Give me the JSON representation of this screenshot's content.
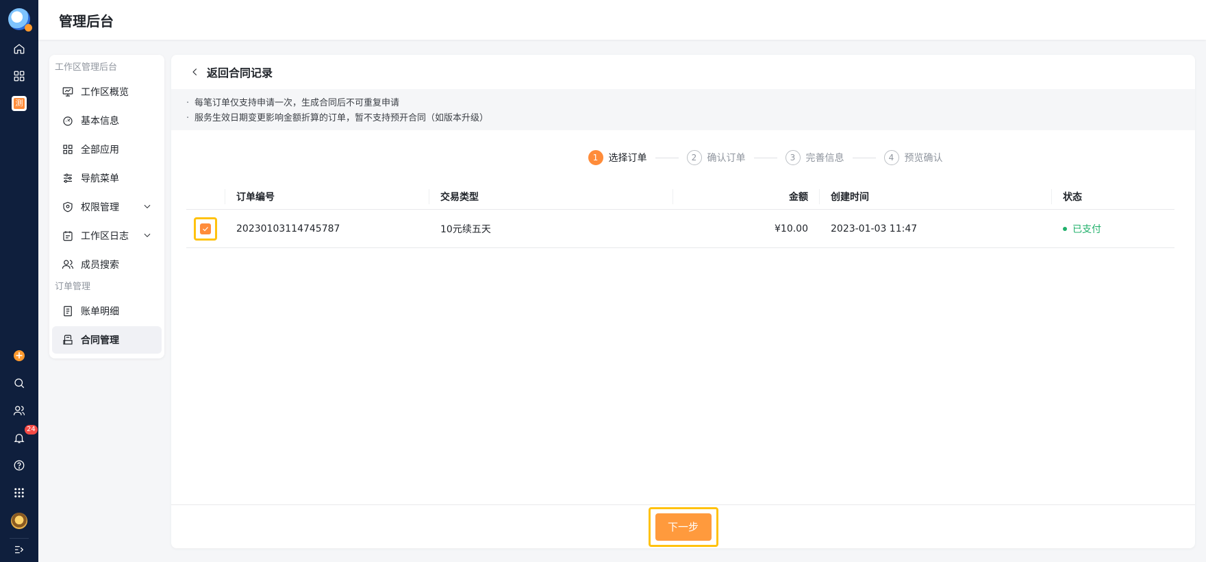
{
  "header": {
    "title": "管理后台"
  },
  "rail": {
    "notification_count": "24",
    "app_glyph": "测"
  },
  "sidenav": {
    "group_workspace": "工作区管理后台",
    "items_workspace": [
      {
        "label": "工作区概览",
        "icon": "monitor-icon"
      },
      {
        "label": "基本信息",
        "icon": "dashboard-icon"
      },
      {
        "label": "全部应用",
        "icon": "grid-icon"
      },
      {
        "label": "导航菜单",
        "icon": "sliders-icon"
      },
      {
        "label": "权限管理",
        "icon": "shield-icon"
      },
      {
        "label": "工作区日志",
        "icon": "calendar-icon"
      },
      {
        "label": "成员搜索",
        "icon": "users-icon"
      }
    ],
    "group_orders": "订单管理",
    "items_orders": [
      {
        "label": "账单明细",
        "icon": "document-icon"
      },
      {
        "label": "合同管理",
        "icon": "contract-icon",
        "active": true
      }
    ]
  },
  "main": {
    "back_label": "返回合同记录",
    "notices": [
      "每笔订单仅支持申请一次，生成合同后不可重复申请",
      "服务生效日期变更影响金额折算的订单，暂不支持预开合同（如版本升级）"
    ],
    "steps": [
      {
        "num": "1",
        "label": "选择订单"
      },
      {
        "num": "2",
        "label": "确认订单"
      },
      {
        "num": "3",
        "label": "完善信息"
      },
      {
        "num": "4",
        "label": "预览确认"
      }
    ],
    "table": {
      "headers": {
        "id": "订单编号",
        "type": "交易类型",
        "amount": "金额",
        "time": "创建时间",
        "status": "状态"
      },
      "rows": [
        {
          "id": "20230103114745787",
          "type": "10元续五天",
          "amount": "¥10.00",
          "time": "2023-01-03 11:47",
          "status": "已支付",
          "checked": true
        }
      ]
    },
    "next_label": "下一步"
  },
  "colors": {
    "accent": "#ff8c3a",
    "success": "#1fb06a",
    "highlight": "#ffc20e",
    "rail_bg": "#0f1f3d"
  }
}
